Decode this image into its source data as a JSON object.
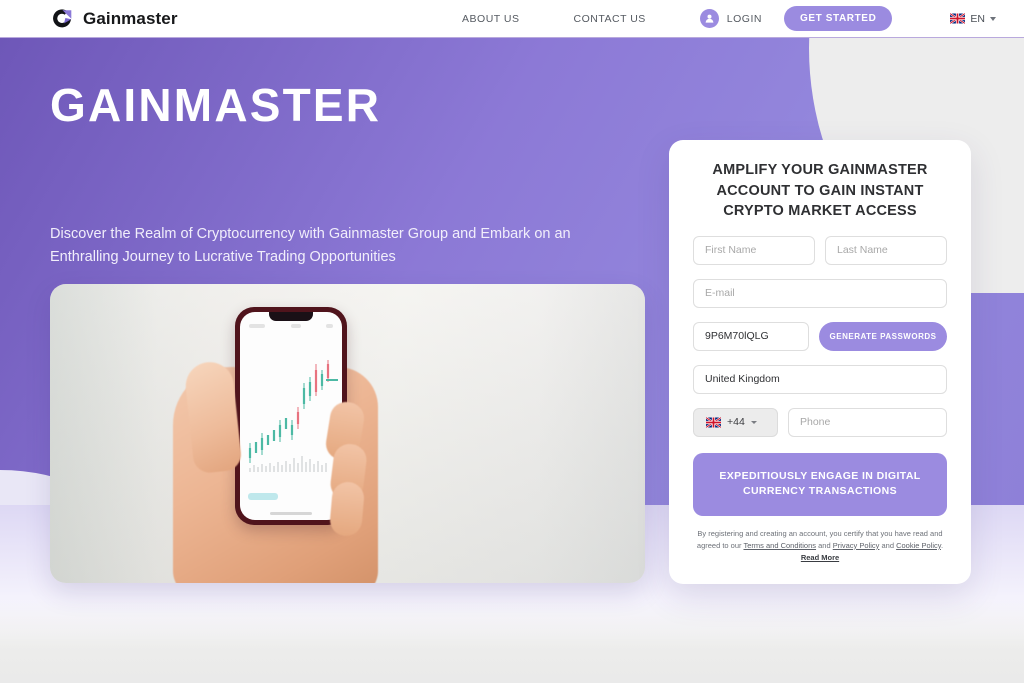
{
  "header": {
    "brand": "Gainmaster",
    "brand_icon": "gainmaster-swoosh-logo",
    "nav": [
      {
        "label": "ABOUT US",
        "name": "about-us"
      },
      {
        "label": "CONTACT US",
        "name": "contact-us"
      }
    ],
    "login_label": "LOGIN",
    "login_icon": "user-avatar-icon",
    "get_started_label": "GET STARTED",
    "language": {
      "code": "EN",
      "flag": "uk-flag-icon",
      "caret": "chevron-down-icon"
    }
  },
  "hero": {
    "title": "GAINMASTER",
    "subtitle": "Discover the Realm of Cryptocurrency with Gainmaster Group and Embark on an Enthralling Journey to Lucrative Trading Opportunities",
    "photo_alt": "hand-holding-phone-with-candlestick-chart"
  },
  "signup": {
    "title": "AMPLIFY YOUR GAINMASTER ACCOUNT TO GAIN INSTANT CRYPTO MARKET ACCESS",
    "first_name_placeholder": "First Name",
    "last_name_placeholder": "Last Name",
    "email_placeholder": "E-mail",
    "password_value": "9P6M70lQLG",
    "generate_label": "GENERATE PASSWORDS",
    "country_value": "United Kingdom",
    "country_flag": "uk-flag-icon",
    "dial_code": "+44",
    "phone_placeholder": "Phone",
    "submit_label": "EXPEDITIOUSLY ENGAGE IN DIGITAL CURRENCY TRANSACTIONS",
    "legal": {
      "part1": "By registering and creating an account, you certify that you have read and agreed to our ",
      "terms": "Terms and Conditions",
      "sep1": " and ",
      "privacy": "Privacy Policy",
      "sep2": " and ",
      "cookie": "Cookie Policy",
      "sep3": ". ",
      "read_more": "Read More"
    }
  },
  "colors": {
    "accent": "#9b8be0",
    "hero_purple": "#8c79d6",
    "hero_purple_dark": "#6e57b8",
    "page_bg": "#ededed"
  }
}
